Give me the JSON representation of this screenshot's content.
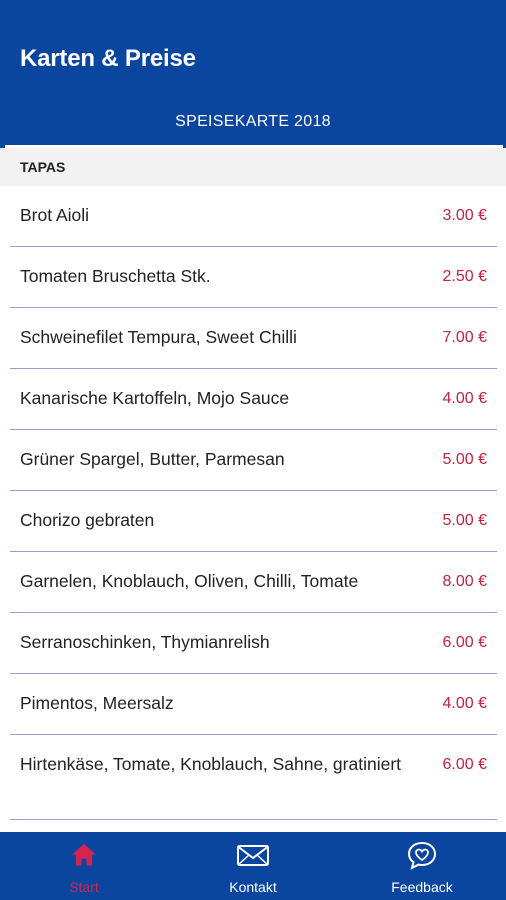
{
  "app": {
    "title": "Karten & Preise"
  },
  "tabs": [
    {
      "label": "SPEISEKARTE 2018",
      "active": true
    }
  ],
  "section": {
    "title": "TAPAS"
  },
  "items": [
    {
      "name": "Brot Aioli",
      "price": "3.00 €"
    },
    {
      "name": "Tomaten Bruschetta Stk.",
      "price": "2.50 €"
    },
    {
      "name": "Schweinefilet Tempura, Sweet Chilli",
      "price": "7.00 €"
    },
    {
      "name": "Kanarische Kartoffeln, Mojo Sauce",
      "price": "4.00 €"
    },
    {
      "name": "Grüner Spargel, Butter, Parmesan",
      "price": "5.00 €"
    },
    {
      "name": "Chorizo gebraten",
      "price": "5.00 €"
    },
    {
      "name": "Garnelen, Knoblauch, Oliven, Chilli, Tomate",
      "price": "8.00 €"
    },
    {
      "name": "Serranoschinken, Thymianrelish",
      "price": "6.00 €"
    },
    {
      "name": "Pimentos, Meersalz",
      "price": "4.00 €"
    },
    {
      "name": "Hirtenkäse, Tomate, Knoblauch, Sahne, gratiniert",
      "price": "6.00 €"
    }
  ],
  "bottom_nav": [
    {
      "label": "Start",
      "icon": "home-icon",
      "active": true
    },
    {
      "label": "Kontakt",
      "icon": "mail-icon",
      "active": false
    },
    {
      "label": "Feedback",
      "icon": "heart-chat-icon",
      "active": false
    }
  ],
  "colors": {
    "primary": "#0a46a0",
    "price": "#c4223f",
    "active_nav": "#d22550",
    "divider": "#9a9ccc",
    "section_bg": "#f2f2f2"
  }
}
